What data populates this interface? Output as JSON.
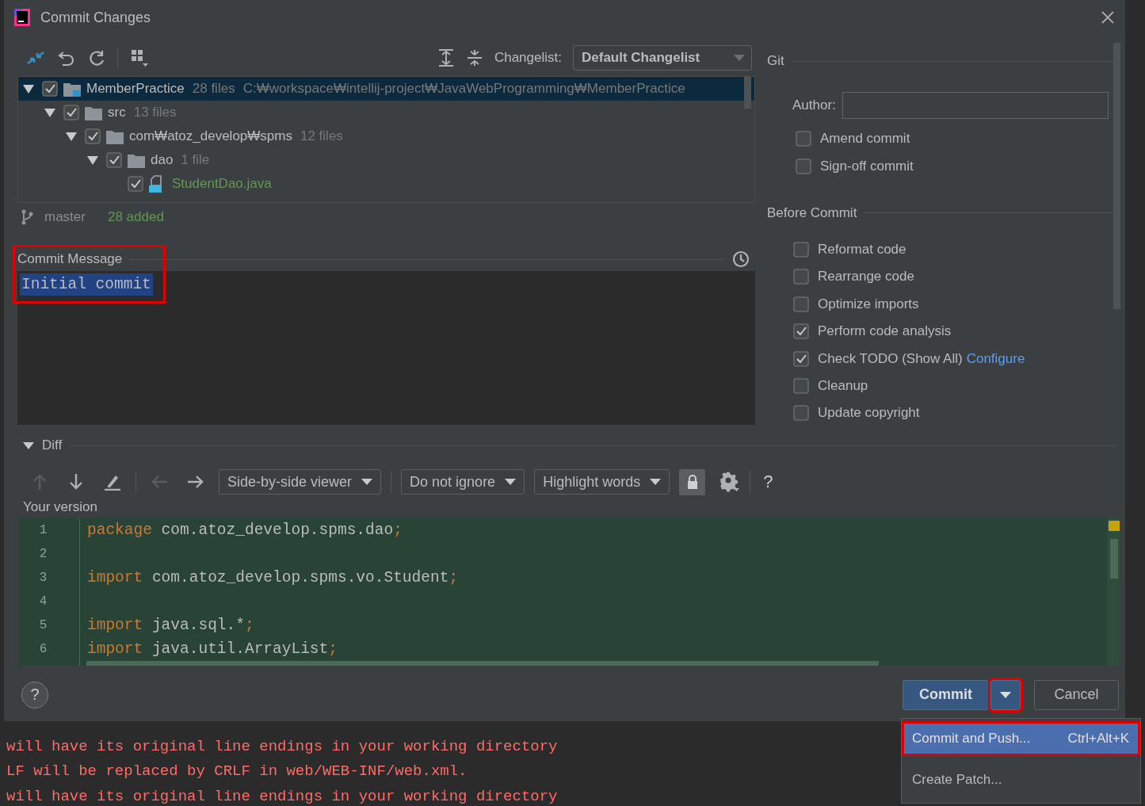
{
  "window": {
    "title": "Commit Changes"
  },
  "toolbar": {
    "changelist_label": "Changelist:",
    "changelist": "Default Changelist"
  },
  "tree": [
    {
      "kind": "module",
      "name": "MemberPractice",
      "count": "28 files",
      "path": "C:₩workspace₩intellij-project₩JavaWebProgramming₩MemberPractice",
      "checked": true,
      "expanded": true,
      "selected": true,
      "children": [
        {
          "kind": "folder",
          "name": "src",
          "count": "13 files",
          "checked": true,
          "expanded": true,
          "selected": false,
          "children": [
            {
              "kind": "folder",
              "name": "com₩atoz_develop₩spms",
              "count": "12 files",
              "checked": true,
              "expanded": true,
              "selected": false,
              "children": [
                {
                  "kind": "folder",
                  "name": "dao",
                  "count": "1 file",
                  "checked": true,
                  "expanded": true,
                  "selected": false,
                  "children": [
                    {
                      "kind": "file",
                      "name": "StudentDao.java",
                      "checked": true,
                      "selected": false
                    }
                  ]
                }
              ]
            }
          ]
        }
      ]
    }
  ],
  "status": {
    "branch": "master",
    "summary": "28 added"
  },
  "commit_message": {
    "label": "Commit Message",
    "text": "Initial commit",
    "annotated": true
  },
  "git": {
    "title": "Git",
    "author_label": "Author:",
    "options": [
      {
        "label": "Amend commit",
        "checked": false
      },
      {
        "label": "Sign-off commit",
        "checked": false
      }
    ]
  },
  "before_commit": {
    "title": "Before Commit",
    "options": [
      {
        "label": "Reformat code",
        "checked": false
      },
      {
        "label": "Rearrange code",
        "checked": false
      },
      {
        "label": "Optimize imports",
        "checked": false
      },
      {
        "label": "Perform code analysis",
        "checked": true
      },
      {
        "label": "Check TODO (Show All)",
        "checked": true,
        "link": "Configure"
      },
      {
        "label": "Cleanup",
        "checked": false
      },
      {
        "label": "Update copyright",
        "checked": false
      }
    ]
  },
  "diff": {
    "title": "Diff",
    "expanded": true,
    "tools": [
      {
        "kind": "up",
        "disabled": true
      },
      {
        "kind": "down",
        "disabled": false
      },
      {
        "kind": "edit",
        "disabled": false
      },
      {
        "kind": "left",
        "disabled": true
      },
      {
        "kind": "right",
        "disabled": false
      }
    ],
    "dropdowns": [
      "Side-by-side viewer",
      "Do not ignore",
      "Highlight words"
    ],
    "lock_on": true,
    "help": "?",
    "pane_title": "Your version",
    "lines": [
      {
        "number": "1",
        "code": [
          {
            "kind": "keyword",
            "text": "package"
          },
          {
            "kind": "plain",
            "text": " com.atoz_develop.spms.dao"
          },
          {
            "kind": "punct",
            "text": ";"
          }
        ]
      },
      {
        "number": "2"
      },
      {
        "number": "3",
        "code": [
          {
            "kind": "keyword",
            "text": "import"
          },
          {
            "kind": "plain",
            "text": " com.atoz_develop.spms.vo.Student"
          },
          {
            "kind": "punct",
            "text": ";"
          }
        ]
      },
      {
        "number": "4"
      },
      {
        "number": "5",
        "code": [
          {
            "kind": "keyword",
            "text": "import"
          },
          {
            "kind": "plain",
            "text": " java.sql.*"
          },
          {
            "kind": "punct",
            "text": ";"
          }
        ]
      },
      {
        "number": "6",
        "code": [
          {
            "kind": "keyword",
            "text": "import"
          },
          {
            "kind": "plain",
            "text": " java.util.ArrayList"
          },
          {
            "kind": "punct",
            "text": ";"
          }
        ]
      }
    ]
  },
  "buttons": {
    "help": "?",
    "commit": "Commit",
    "commit_menu_annotated": true,
    "cancel": "Cancel"
  },
  "menu": [
    {
      "label": "Commit and Push...",
      "shortcut": "Ctrl+Alt+K",
      "selected": true,
      "annotated": true
    },
    {
      "label": "Create Patch...",
      "selected": false,
      "annotated": false
    }
  ],
  "console": [
    "will have its original line endings in your working directory",
    "LF will be replaced by CRLF in web/WEB-INF/web.xml.",
    "will have its original line endings in your working directory"
  ]
}
